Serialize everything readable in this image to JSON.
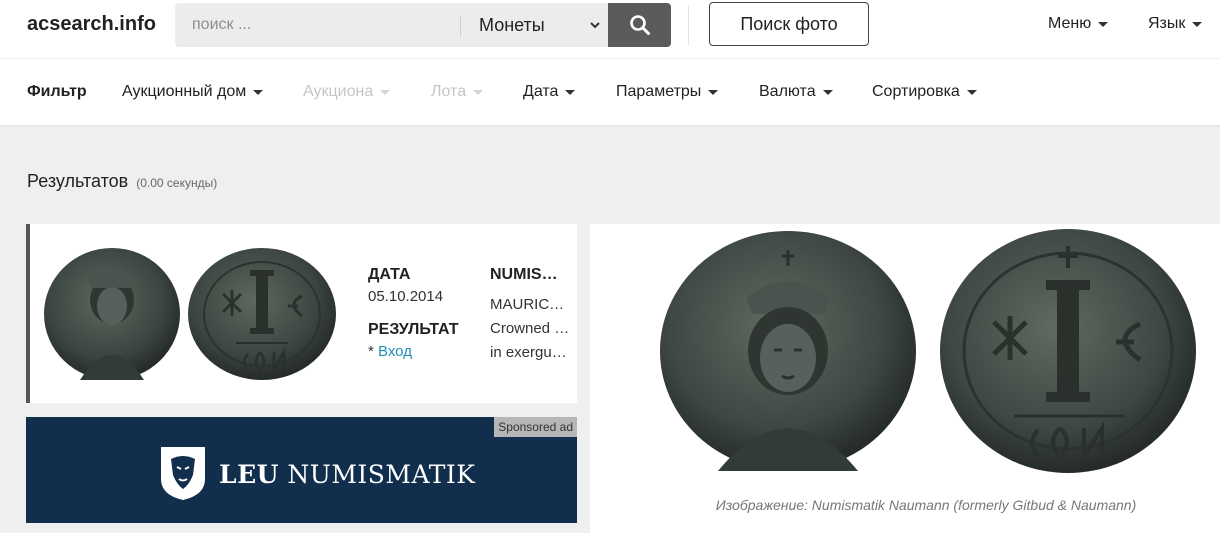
{
  "header": {
    "logo": "acsearch.info",
    "search_placeholder": "поиск ...",
    "category": "Монеты",
    "photo_search_label": "Поиск фото",
    "menu_label": "Меню",
    "language_label": "Язык"
  },
  "filters": {
    "title": "Фильтр",
    "auction_house": "Аукционный дом",
    "auctions": "Аукциона",
    "lots": "Лота",
    "date": "Дата",
    "parameters": "Параметры",
    "currency": "Валюта",
    "sort": "Сортировка"
  },
  "results": {
    "label": "Результатов",
    "time": "(0.00 секунды)"
  },
  "card": {
    "date_label": "ДАТА",
    "date_value": "05.10.2014",
    "result_label": "РЕЗУЛЬТАТ",
    "result_prefix": "* ",
    "result_link": "Вход",
    "auction_heading": "NUMISMATIK NAUMANN",
    "desc_line1": "MAURICE TIBERIUS",
    "desc_line2": "Crowned facing bust",
    "desc_line3": "in exergue CON"
  },
  "ad": {
    "sponsored_label": "Sponsored ad",
    "brand_bold": "LEU",
    "brand_rest": "NUMISMATIK",
    "background_color": "#112f4c"
  },
  "preview": {
    "caption": "Изображение: Numismatik Naumann (formerly Gitbud & Naumann)"
  },
  "colors": {
    "link": "#1f8fb7",
    "search_button": "#5b5b5b",
    "disabled_text": "#c5c5c5"
  }
}
